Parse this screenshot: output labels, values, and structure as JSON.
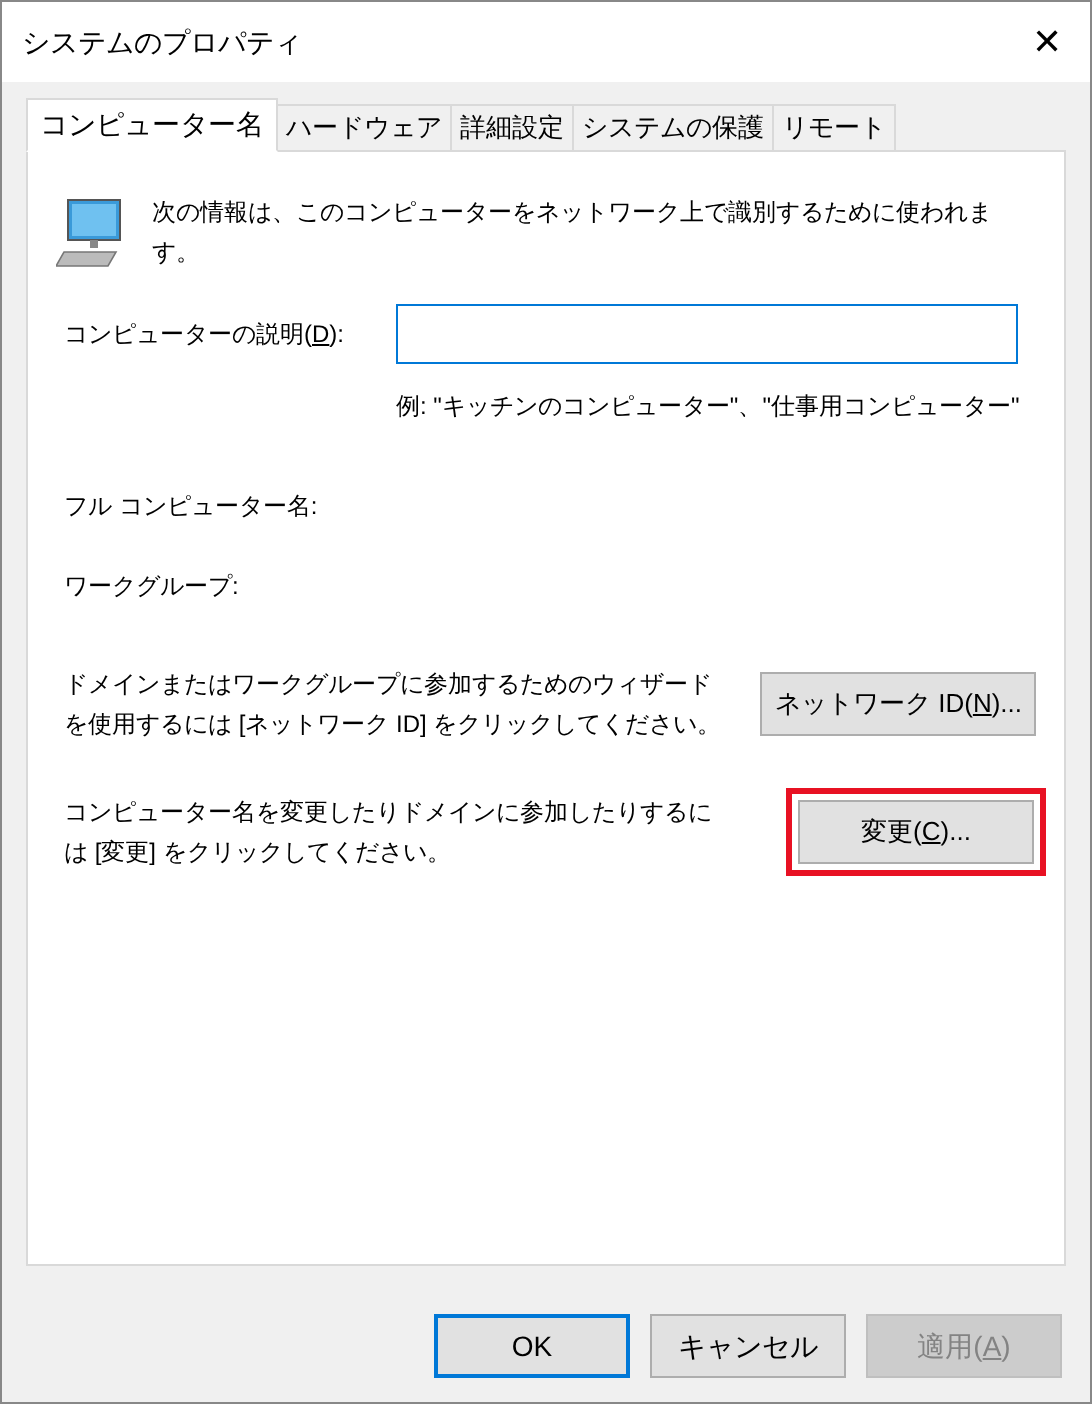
{
  "window": {
    "title": "システムのプロパティ",
    "close": "✕"
  },
  "tabs": [
    {
      "label": "コンピューター名",
      "selected": true
    },
    {
      "label": "ハードウェア",
      "selected": false
    },
    {
      "label": "詳細設定",
      "selected": false
    },
    {
      "label": "システムの保護",
      "selected": false
    },
    {
      "label": "リモート",
      "selected": false
    }
  ],
  "intro": "次の情報は、このコンピューターをネットワーク上で識別するために使われます。",
  "description": {
    "label": {
      "before": "コンピューターの説明(",
      "key": "D",
      "after": "):"
    },
    "example": "例: \"キッチンのコンピューター\"、\"仕事用コンピューター\""
  },
  "full_name_label": "フル コンピューター名:",
  "workgroup_label": "ワークグループ:",
  "actions": [
    {
      "text": "ドメインまたはワークグループに参加するためのウィザードを使用するには [ネットワーク ID] をクリックしてください。",
      "button": {
        "before": "ネットワーク ID(",
        "key": "N",
        "after": ")..."
      },
      "highlighted": false
    },
    {
      "text": "コンピューター名を変更したりドメインに参加したりするには [変更] をクリックしてください。",
      "button": {
        "before": "変更(",
        "key": "C",
        "after": ")..."
      },
      "highlighted": true
    }
  ],
  "buttons": [
    {
      "label": {
        "before": "OK"
      },
      "default": true,
      "disabled": false
    },
    {
      "label": {
        "before": "キャンセル"
      },
      "default": false,
      "disabled": false
    },
    {
      "label": {
        "before": "適用(",
        "key": "A",
        "after": ")"
      },
      "default": false,
      "disabled": true
    }
  ]
}
